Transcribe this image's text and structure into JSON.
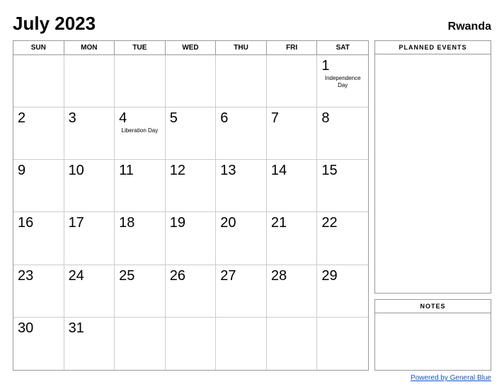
{
  "header": {
    "month_year": "July 2023",
    "country": "Rwanda"
  },
  "day_headers": [
    "SUN",
    "MON",
    "TUE",
    "WED",
    "THU",
    "FRI",
    "SAT"
  ],
  "weeks": [
    [
      {
        "day": "",
        "event": ""
      },
      {
        "day": "",
        "event": ""
      },
      {
        "day": "",
        "event": ""
      },
      {
        "day": "",
        "event": ""
      },
      {
        "day": "",
        "event": ""
      },
      {
        "day": "",
        "event": ""
      },
      {
        "day": "1",
        "event": "Independence\nDay"
      }
    ],
    [
      {
        "day": "2",
        "event": ""
      },
      {
        "day": "3",
        "event": ""
      },
      {
        "day": "4",
        "event": "Liberation Day"
      },
      {
        "day": "5",
        "event": ""
      },
      {
        "day": "6",
        "event": ""
      },
      {
        "day": "7",
        "event": ""
      },
      {
        "day": "8",
        "event": ""
      }
    ],
    [
      {
        "day": "9",
        "event": ""
      },
      {
        "day": "10",
        "event": ""
      },
      {
        "day": "11",
        "event": ""
      },
      {
        "day": "12",
        "event": ""
      },
      {
        "day": "13",
        "event": ""
      },
      {
        "day": "14",
        "event": ""
      },
      {
        "day": "15",
        "event": ""
      }
    ],
    [
      {
        "day": "16",
        "event": ""
      },
      {
        "day": "17",
        "event": ""
      },
      {
        "day": "18",
        "event": ""
      },
      {
        "day": "19",
        "event": ""
      },
      {
        "day": "20",
        "event": ""
      },
      {
        "day": "21",
        "event": ""
      },
      {
        "day": "22",
        "event": ""
      }
    ],
    [
      {
        "day": "23",
        "event": ""
      },
      {
        "day": "24",
        "event": ""
      },
      {
        "day": "25",
        "event": ""
      },
      {
        "day": "26",
        "event": ""
      },
      {
        "day": "27",
        "event": ""
      },
      {
        "day": "28",
        "event": ""
      },
      {
        "day": "29",
        "event": ""
      }
    ],
    [
      {
        "day": "30",
        "event": ""
      },
      {
        "day": "31",
        "event": ""
      },
      {
        "day": "",
        "event": ""
      },
      {
        "day": "",
        "event": ""
      },
      {
        "day": "",
        "event": ""
      },
      {
        "day": "",
        "event": ""
      },
      {
        "day": "",
        "event": ""
      }
    ]
  ],
  "sidebar": {
    "planned_events_label": "PLANNED EVENTS",
    "notes_label": "NOTES"
  },
  "footer": {
    "link_text": "Powered by General Blue",
    "link_url": "#"
  }
}
